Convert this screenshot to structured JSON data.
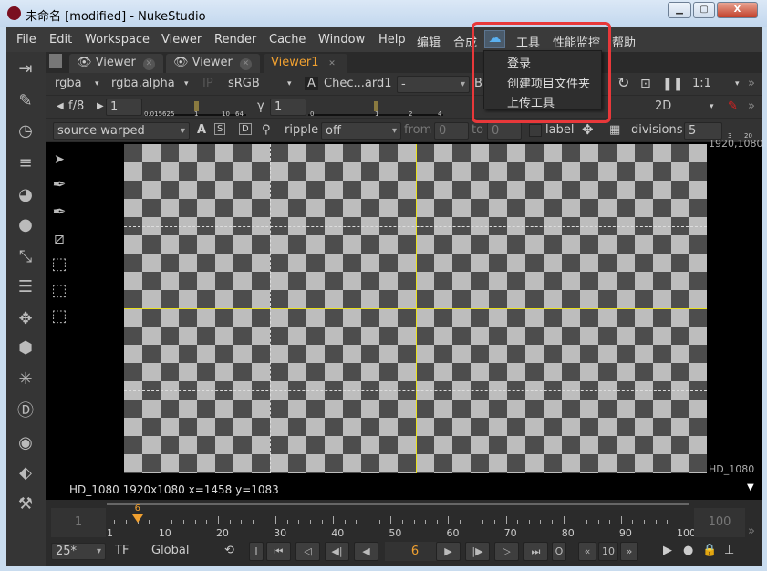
{
  "window": {
    "title": "未命名 [modified] - NukeStudio",
    "controls": [
      "minimize",
      "maximize",
      "close"
    ]
  },
  "menubar": {
    "items": [
      "File",
      "Edit",
      "Workspace",
      "Viewer",
      "Render",
      "Cache",
      "Window",
      "Help",
      "编辑",
      "合成",
      "工具",
      "性能监控",
      "帮助"
    ],
    "plugin_icon": "cloud-link-icon"
  },
  "dropdown": {
    "items": [
      "登录",
      "创建项目文件夹",
      "上传工具"
    ]
  },
  "tabs": [
    {
      "label": "Viewer",
      "active": false
    },
    {
      "label": "Viewer",
      "active": false
    },
    {
      "label": "Viewer1",
      "active": true
    }
  ],
  "toolbar1": {
    "channels": "rgba",
    "channel": "rgba.alpha",
    "ip": "IP",
    "lut": "sRGB",
    "a_label": "A",
    "a_input": "Chec...ard1",
    "b_input": "-",
    "b_label": "B",
    "zoom": "1:1"
  },
  "toolbar2": {
    "fstop": "f/8",
    "gain": "1",
    "gain_ticks": [
      "0.015625",
      "1",
      "10",
      "64"
    ],
    "gamma_label": "γ",
    "gamma": "1",
    "gamma_ticks": [
      "0",
      "1",
      "2",
      "4"
    ],
    "view_mode": "2D"
  },
  "toolbar3": {
    "mode": "source warped",
    "ripple_label": "ripple",
    "ripple": "off",
    "from_label": "from",
    "from": "0",
    "to_label": "to",
    "to": "0",
    "label": "label",
    "divisions_label": "divisions",
    "divisions": "5",
    "div_ticks": [
      "3",
      "20"
    ]
  },
  "viewer": {
    "format_top": "1920,1080",
    "format_bottom": "HD_1080",
    "guide_color": "#e8e020"
  },
  "infobar": {
    "text": "HD_1080 1920x1080  x=1458 y=1083"
  },
  "timeline": {
    "start": "1",
    "end": "100",
    "current": "6",
    "ticks": [
      "1",
      "10",
      "20",
      "30",
      "40",
      "50",
      "60",
      "70",
      "80",
      "90",
      "100"
    ],
    "accent": "#f0a030"
  },
  "playback": {
    "fps": "25*",
    "tf": "TF",
    "scope": "Global",
    "in": "I",
    "out": "O",
    "frame": "6",
    "step": "10"
  }
}
